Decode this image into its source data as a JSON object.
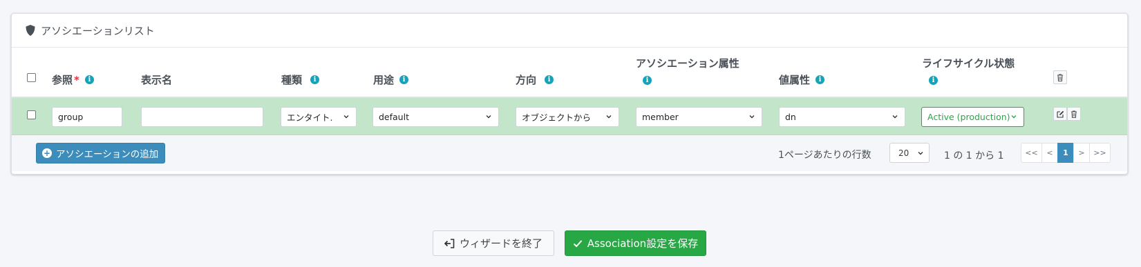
{
  "card": {
    "title": "アソシエーションリスト",
    "title_icon": "shield-icon"
  },
  "columns": {
    "reference": "参照",
    "required_mark": "*",
    "display_name": "表示名",
    "kind": "種類",
    "intent": "用途",
    "direction": "方向",
    "association_attribute": "アソシエーション属性",
    "value_attribute": "値属性",
    "lifecycle_state": "ライフサイクル状態",
    "info_glyph": "i"
  },
  "rows": [
    {
      "reference": "group",
      "display_name": "",
      "kind": "エンタイト.",
      "intent": "default",
      "direction": "オブジェクトから",
      "association_attribute": "member",
      "value_attribute": "dn",
      "lifecycle_state": "Active (production)"
    }
  ],
  "footer": {
    "add_button": "アソシエーションの追加",
    "rows_per_page_label": "1ページあたりの行数",
    "rows_per_page_value": "20",
    "range_text": "1 の 1 から 1",
    "pager": {
      "first": "<<",
      "prev": "<",
      "current": "1",
      "next": ">",
      "last": ">>"
    }
  },
  "actions": {
    "exit_wizard": "ウィザードを終了",
    "save": "Association設定を保存"
  },
  "colors": {
    "row_highlight": "#c3e6cb",
    "primary": "#3c8dbc",
    "success": "#28a745",
    "info": "#17a2b8",
    "required": "#dc3545"
  }
}
